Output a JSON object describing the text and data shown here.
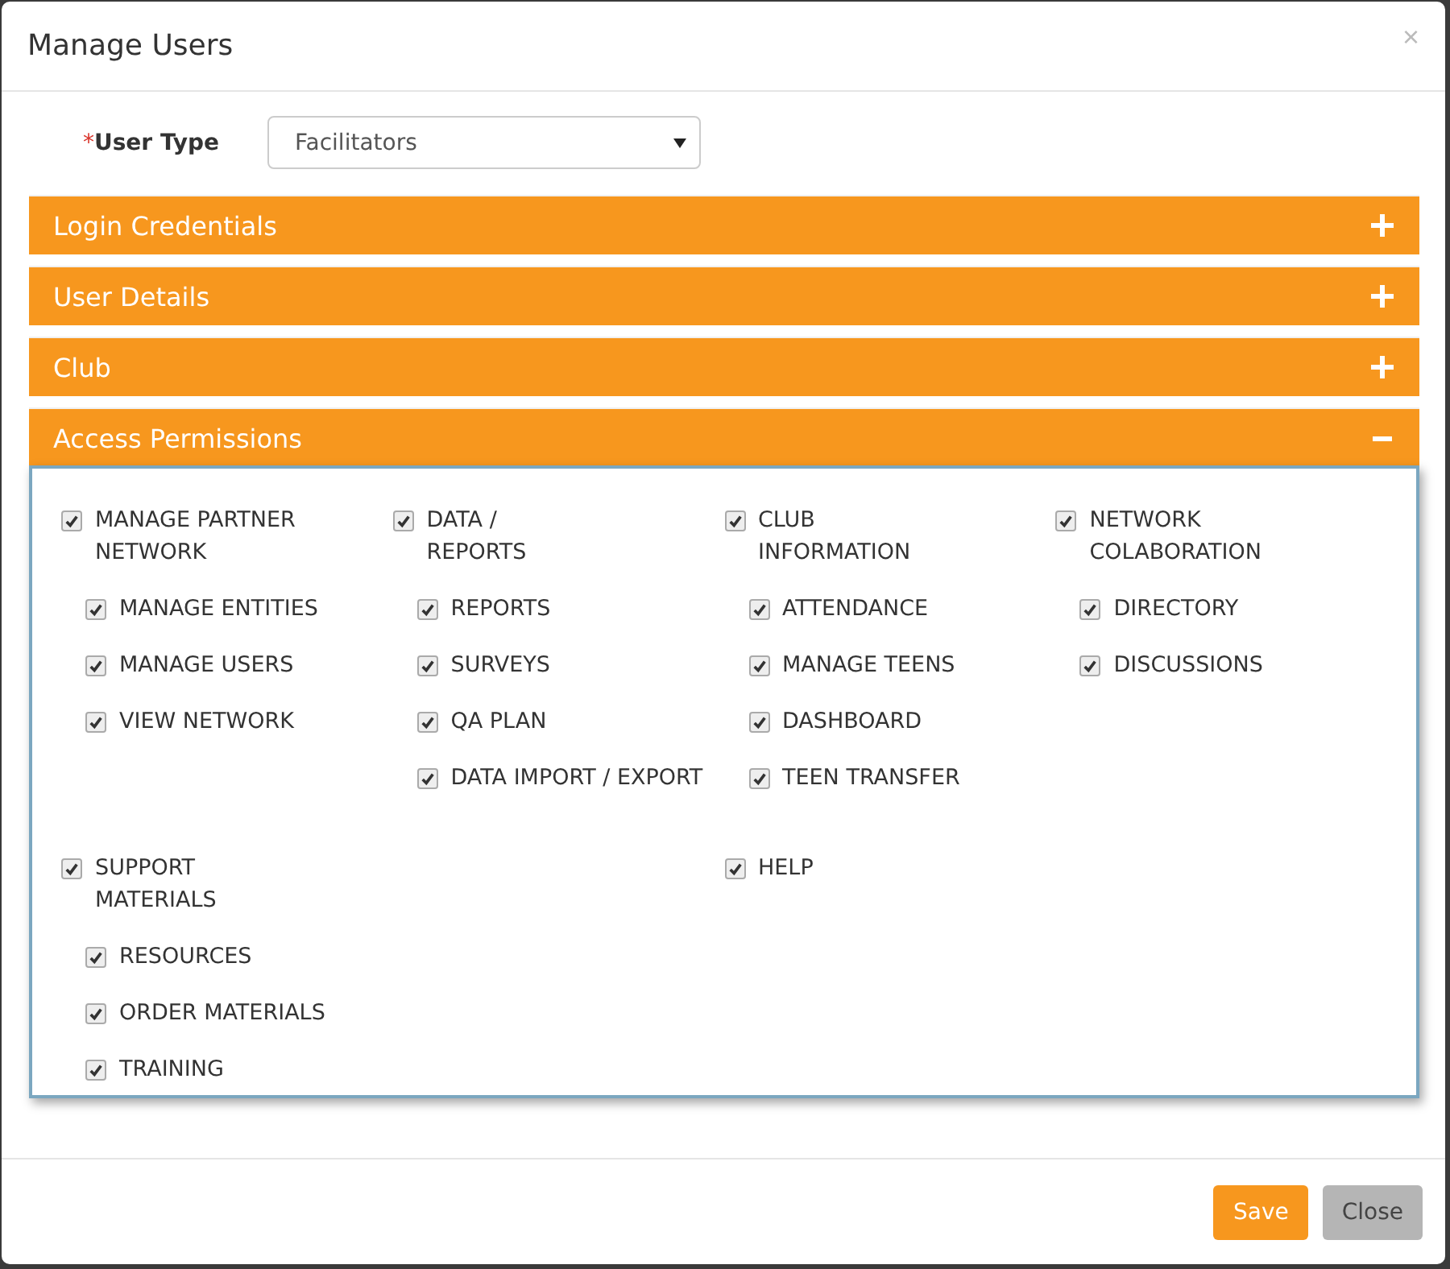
{
  "dialog": {
    "title": "Manage Users",
    "close": "×"
  },
  "user_type": {
    "required_mark": "*",
    "label": "User Type",
    "value": "Facilitators"
  },
  "panels": [
    {
      "title": "Login Credentials",
      "expanded": false
    },
    {
      "title": "User Details",
      "expanded": false
    },
    {
      "title": "Club",
      "expanded": false
    },
    {
      "title": "Access Permissions",
      "expanded": true
    }
  ],
  "permission_rows": [
    {
      "halves": [
        [
          {
            "title": "MANAGE PARTNER\nNETWORK",
            "checked": true,
            "children": [
              {
                "label": "MANAGE ENTITIES",
                "checked": true
              },
              {
                "label": "MANAGE USERS",
                "checked": true
              },
              {
                "label": "VIEW NETWORK",
                "checked": true
              }
            ]
          },
          {
            "title": "DATA /\nREPORTS",
            "checked": true,
            "children": [
              {
                "label": "REPORTS",
                "checked": true
              },
              {
                "label": "SURVEYS",
                "checked": true
              },
              {
                "label": "QA PLAN",
                "checked": true
              },
              {
                "label": "DATA IMPORT / EXPORT",
                "checked": true
              }
            ]
          }
        ],
        [
          {
            "title": "CLUB\nINFORMATION",
            "checked": true,
            "children": [
              {
                "label": "ATTENDANCE",
                "checked": true
              },
              {
                "label": "MANAGE TEENS",
                "checked": true
              },
              {
                "label": "DASHBOARD",
                "checked": true
              },
              {
                "label": "TEEN TRANSFER",
                "checked": true
              }
            ]
          },
          {
            "title": "NETWORK\nCOLABORATION",
            "checked": true,
            "children": [
              {
                "label": "DIRECTORY",
                "checked": true
              },
              {
                "label": "DISCUSSIONS",
                "checked": true
              }
            ]
          }
        ]
      ]
    },
    {
      "halves": [
        [
          {
            "title": "SUPPORT\nMATERIALS",
            "checked": true,
            "children": [
              {
                "label": "RESOURCES",
                "checked": true
              },
              {
                "label": "ORDER MATERIALS",
                "checked": true
              },
              {
                "label": "TRAINING",
                "checked": true
              }
            ]
          }
        ],
        [
          {
            "title": "HELP",
            "checked": true
          }
        ]
      ]
    }
  ],
  "buttons": [
    {
      "label": "Save",
      "kind": "primary"
    },
    {
      "label": "Close",
      "kind": "secondary"
    }
  ]
}
